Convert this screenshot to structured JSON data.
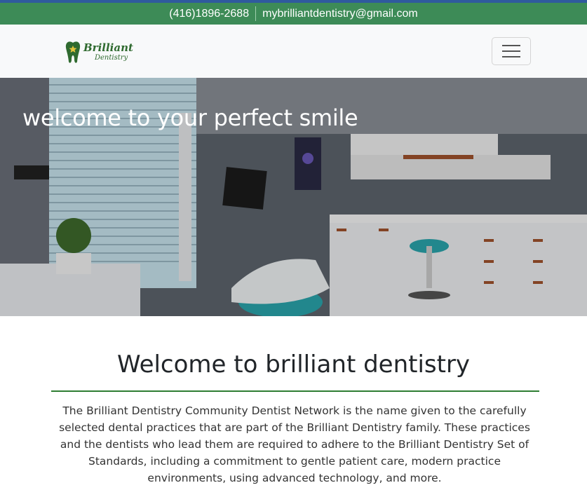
{
  "contact": {
    "phone": "(416)1896-2688",
    "email": "mybrilliantdentistry@gmail.com"
  },
  "brand": {
    "line1": "Brilliant",
    "line2": "Dentistry"
  },
  "hero": {
    "title": "welcome to your perfect smile"
  },
  "welcome": {
    "heading": "Welcome to brilliant dentistry",
    "body": "The Brilliant Dentistry Community Dentist Network is the name given to the carefully selected dental practices that are part of the Brilliant Dentistry family. These practices and the dentists who lead them are required to adhere to the Brilliant Dentistry Set of Standards, including a commitment to gentle patient care, modern practice environments, using advanced technology, and more."
  },
  "colors": {
    "contact_bar": "#3d8b57",
    "top_line": "#2f5a9e",
    "navbar": "#f8f9fa",
    "divider": "#2e7d32"
  },
  "icons": {
    "logo": "tooth-logo-icon",
    "menu": "hamburger-menu-icon"
  }
}
